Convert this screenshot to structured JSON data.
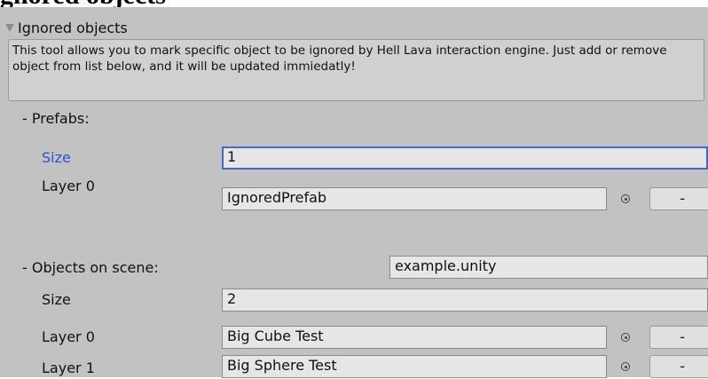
{
  "top_heading": "gnored objects",
  "foldout": {
    "label": "Ignored objects"
  },
  "help": {
    "text": "This tool allows you to mark specific object to be ignored by Hell Lava interaction engine. Just add or remove object from list below, and it will be updated immiedatly!"
  },
  "prefabs": {
    "label": "- Prefabs:",
    "size_label": "Size",
    "size_value": "1",
    "items": [
      {
        "label": "Layer 0",
        "value": "IgnoredPrefab"
      }
    ]
  },
  "scene_objects": {
    "label": "- Objects on scene:",
    "scene_name": "example.unity",
    "size_label": "Size",
    "size_value": "2",
    "items": [
      {
        "label": "Layer 0",
        "value": "Big Cube Test"
      },
      {
        "label": "Layer 1",
        "value": "Big Sphere Test"
      }
    ]
  },
  "remove_button_label": "-",
  "colors": {
    "panel": "#c2c2c2",
    "focus": "#3c6ad6",
    "field": "#e6e6e6"
  }
}
